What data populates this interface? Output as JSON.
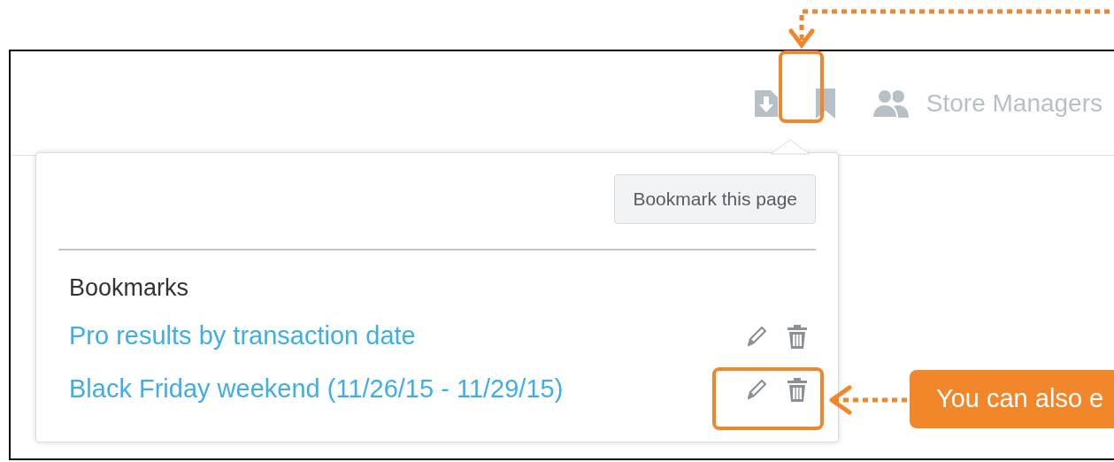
{
  "header": {
    "user_group": "Store Managers"
  },
  "bookmark_popover": {
    "button": "Bookmark this page",
    "heading": "Bookmarks",
    "bookmarks": [
      {
        "title": "Pro results by transaction date"
      },
      {
        "title": "Black Friday weekend (11/26/15 - 11/29/15)"
      }
    ]
  },
  "callout": {
    "text": "You can also e"
  }
}
